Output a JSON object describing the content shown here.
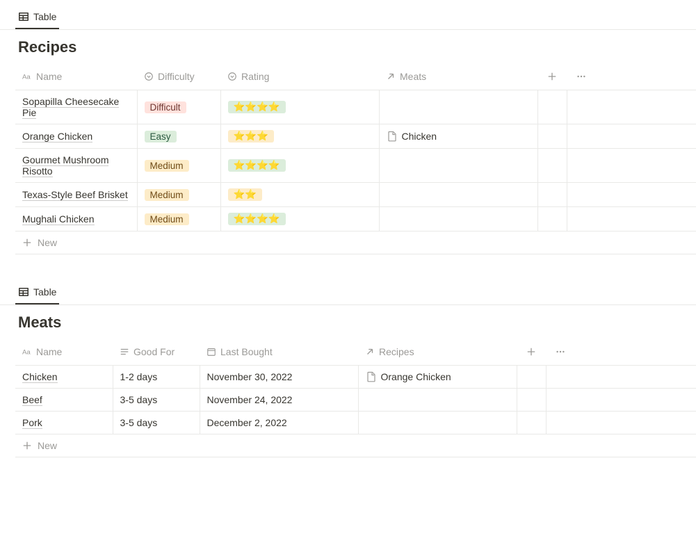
{
  "tab_label": "Table",
  "new_label": "New",
  "recipes": {
    "title": "Recipes",
    "columns": {
      "name": "Name",
      "difficulty": "Difficulty",
      "rating": "Rating",
      "meats": "Meats"
    },
    "rows": [
      {
        "name": "Sopapilla Cheesecake Pie",
        "difficulty": "Difficult",
        "diff_class": "tag-difficult",
        "rating": "⭐⭐⭐⭐",
        "rating_class": "tag-rating-green",
        "meat": ""
      },
      {
        "name": "Orange Chicken",
        "difficulty": "Easy",
        "diff_class": "tag-easy",
        "rating": "⭐⭐⭐",
        "rating_class": "tag-rating-orange",
        "meat": "Chicken"
      },
      {
        "name": "Gourmet Mushroom Risotto",
        "difficulty": "Medium",
        "diff_class": "tag-medium",
        "rating": "⭐⭐⭐⭐",
        "rating_class": "tag-rating-green",
        "meat": ""
      },
      {
        "name": "Texas-Style Beef Brisket",
        "difficulty": "Medium",
        "diff_class": "tag-medium",
        "rating": "⭐⭐",
        "rating_class": "tag-rating-orange",
        "meat": ""
      },
      {
        "name": "Mughali Chicken",
        "difficulty": "Medium",
        "diff_class": "tag-medium",
        "rating": "⭐⭐⭐⭐",
        "rating_class": "tag-rating-green",
        "meat": ""
      }
    ]
  },
  "meats": {
    "title": "Meats",
    "columns": {
      "name": "Name",
      "good_for": "Good For",
      "last_bought": "Last Bought",
      "recipes": "Recipes"
    },
    "rows": [
      {
        "name": "Chicken",
        "good_for": "1-2 days",
        "last_bought": "November 30, 2022",
        "recipe": "Orange Chicken"
      },
      {
        "name": "Beef",
        "good_for": "3-5 days",
        "last_bought": "November 24, 2022",
        "recipe": ""
      },
      {
        "name": "Pork",
        "good_for": "3-5 days",
        "last_bought": "December 2, 2022",
        "recipe": ""
      }
    ]
  }
}
